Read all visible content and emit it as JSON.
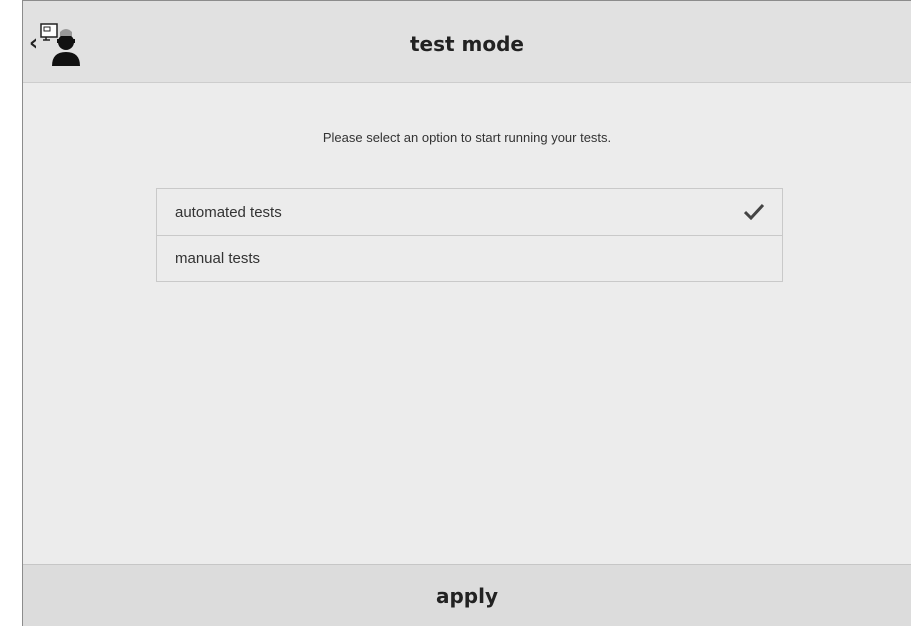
{
  "header": {
    "title": "test mode",
    "back_icon": "chevron-left-icon",
    "avatar_icon": "tester-avatar-icon"
  },
  "main": {
    "instruction": "Please select an option to start running your tests.",
    "options": [
      {
        "label": "automated tests",
        "selected": true
      },
      {
        "label": "manual tests",
        "selected": false
      }
    ],
    "check_icon": "checkmark-icon"
  },
  "footer": {
    "apply_label": "apply"
  },
  "colors": {
    "background": "#ececec",
    "header": "#e1e1e1",
    "footer": "#dcdcdc",
    "text": "#222222",
    "border": "#c9c9c9"
  }
}
